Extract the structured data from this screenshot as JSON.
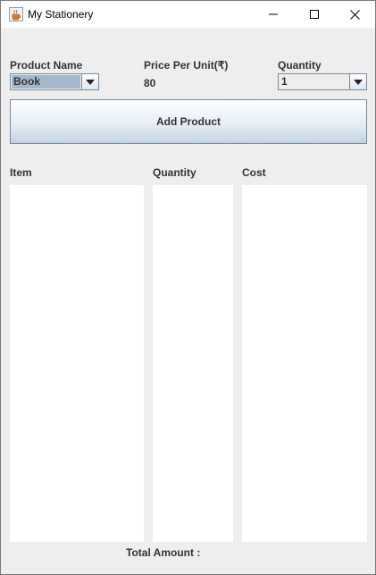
{
  "window": {
    "title": "My Stationery",
    "icon": "java-coffee-cup-icon"
  },
  "form": {
    "product_label": "Product Name",
    "product_value": "Book",
    "price_label": "Price Per Unit(₹)",
    "price_value": "80",
    "quantity_label": "Quantity",
    "quantity_value": "1",
    "add_button": "Add Product"
  },
  "table": {
    "item_header": "Item",
    "quantity_header": "Quantity",
    "cost_header": "Cost"
  },
  "footer": {
    "total_label": "Total Amount :"
  },
  "colors": {
    "selection": "#a3b8cc",
    "button_gradient_bottom": "#c3d3e3",
    "panel_background": "#eeeeee"
  }
}
